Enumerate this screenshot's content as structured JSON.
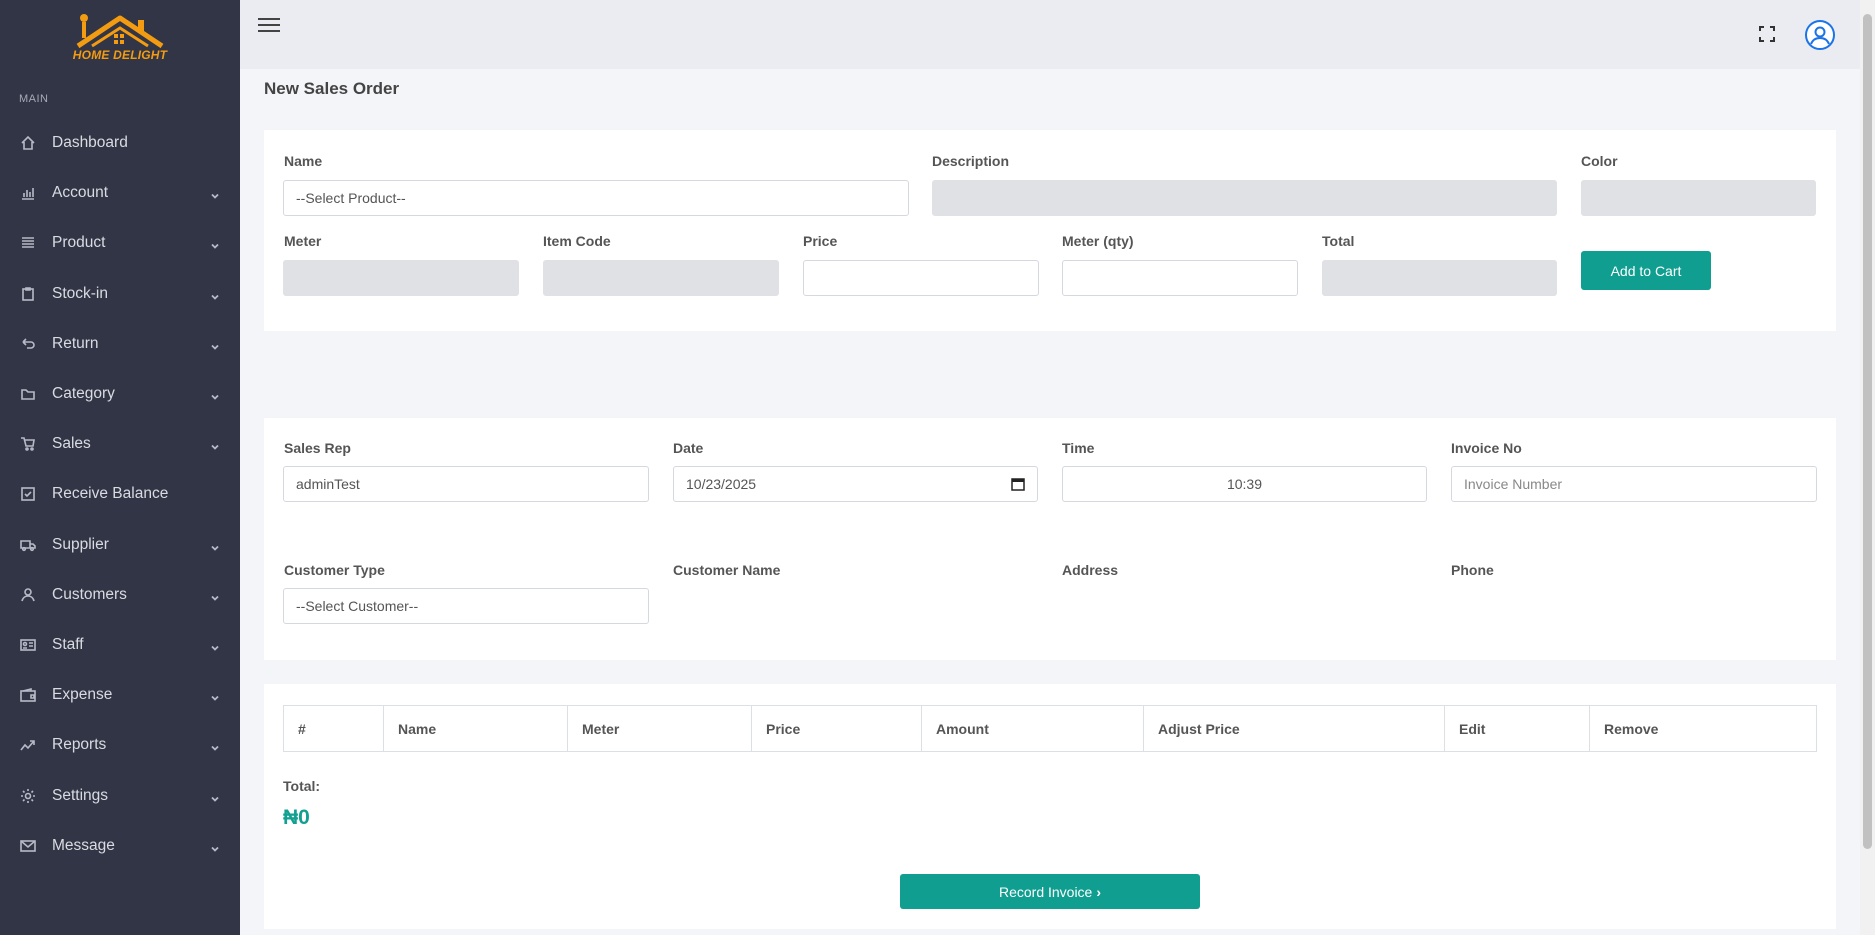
{
  "brand": {
    "name": "HOME DELIGHT",
    "accent": "#f39c12"
  },
  "sidebar": {
    "section_label": "MAIN",
    "items": [
      {
        "label": "Dashboard",
        "icon": "home-icon",
        "has_children": false
      },
      {
        "label": "Account",
        "icon": "bar-chart-icon",
        "has_children": true
      },
      {
        "label": "Product",
        "icon": "list-icon",
        "has_children": true
      },
      {
        "label": "Stock-in",
        "icon": "clipboard-icon",
        "has_children": true
      },
      {
        "label": "Return",
        "icon": "return-icon",
        "has_children": true
      },
      {
        "label": "Category",
        "icon": "folder-icon",
        "has_children": true
      },
      {
        "label": "Sales",
        "icon": "cart-icon",
        "has_children": true
      },
      {
        "label": "Receive Balance",
        "icon": "checkbox-icon",
        "has_children": false
      },
      {
        "label": "Supplier",
        "icon": "truck-icon",
        "has_children": true
      },
      {
        "label": "Customers",
        "icon": "user-icon",
        "has_children": true
      },
      {
        "label": "Staff",
        "icon": "id-card-icon",
        "has_children": true
      },
      {
        "label": "Expense",
        "icon": "wallet-icon",
        "has_children": true
      },
      {
        "label": "Reports",
        "icon": "trend-icon",
        "has_children": true
      },
      {
        "label": "Settings",
        "icon": "gear-icon",
        "has_children": true
      },
      {
        "label": "Message",
        "icon": "mail-icon",
        "has_children": true
      }
    ]
  },
  "page": {
    "title": "New Sales Order"
  },
  "product_form": {
    "name_label": "Name",
    "name_value": "--Select Product--",
    "description_label": "Description",
    "color_label": "Color",
    "meter_label": "Meter",
    "item_code_label": "Item Code",
    "price_label": "Price",
    "meter_qty_label": "Meter (qty)",
    "total_label": "Total",
    "add_to_cart": "Add to Cart"
  },
  "order_form": {
    "sales_rep_label": "Sales Rep",
    "sales_rep_value": "adminTest",
    "date_label": "Date",
    "date_value": "10/23/2025",
    "time_label": "Time",
    "time_value": "10:39",
    "invoice_label": "Invoice No",
    "invoice_placeholder": "Invoice Number",
    "customer_type_label": "Customer Type",
    "customer_type_value": "--Select Customer--",
    "customer_name_label": "Customer Name",
    "address_label": "Address",
    "phone_label": "Phone"
  },
  "cart": {
    "columns": [
      "#",
      "Name",
      "Meter",
      "Price",
      "Amount",
      "Adjust Price",
      "Edit",
      "Remove"
    ],
    "total_label": "Total:",
    "total_value": "₦0",
    "record_button": "Record Invoice"
  }
}
